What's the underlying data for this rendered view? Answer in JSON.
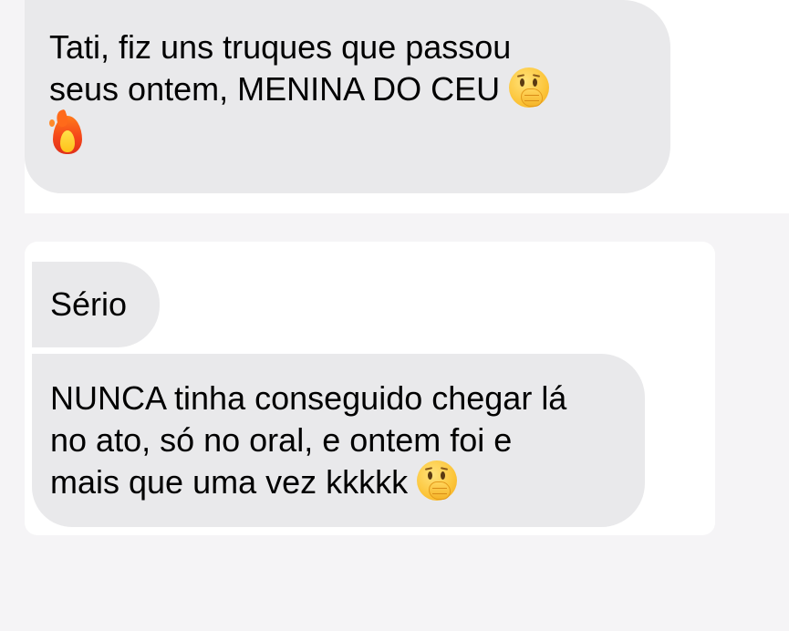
{
  "messages": [
    {
      "lines": [
        "Tati, fiz uns truques que passou",
        "seus ontem, MENINA DO CEU"
      ],
      "emojis": [
        "hand-over-mouth-face-icon",
        "fire-icon"
      ]
    },
    {
      "lines": [
        "Sério"
      ]
    },
    {
      "lines": [
        "NUNCA tinha conseguido chegar lá",
        "no ato, só no oral, e ontem foi e",
        "mais que uma vez kkkkk"
      ],
      "emojis": [
        "hand-over-mouth-face-icon"
      ]
    }
  ],
  "colors": {
    "page_background": "#f5f4f6",
    "card_background": "#ffffff",
    "bubble_background": "#e9e9eb",
    "text": "#000000"
  }
}
